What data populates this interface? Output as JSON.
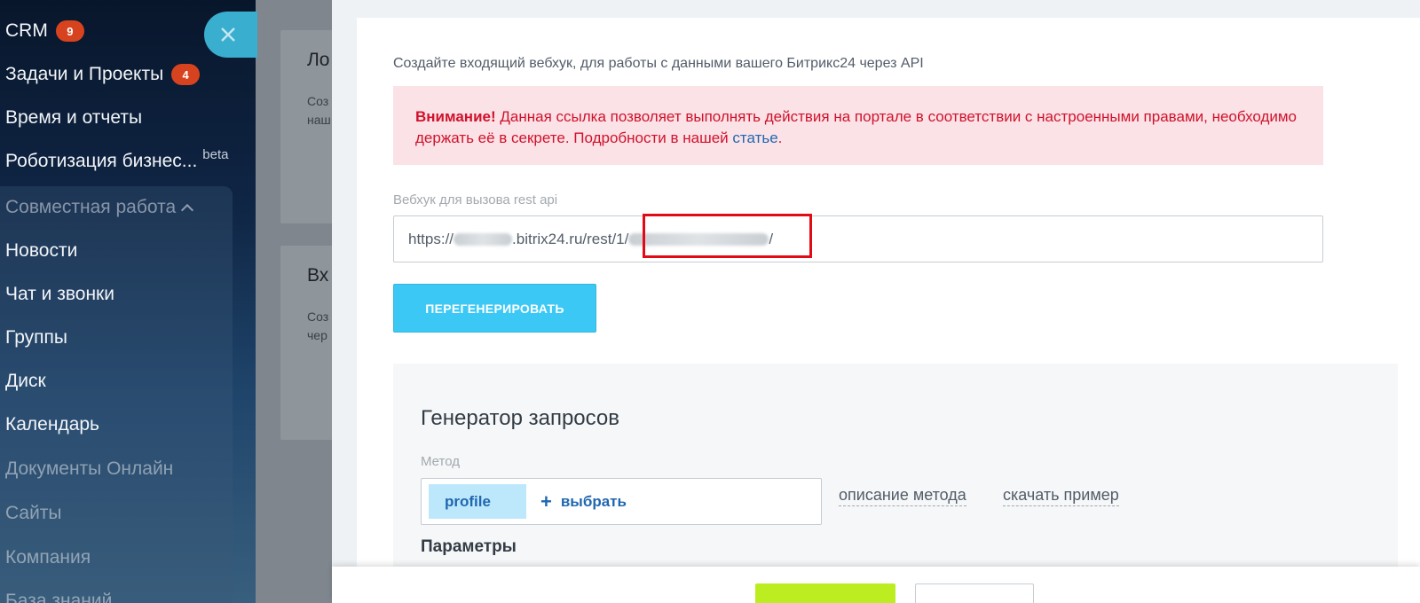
{
  "sidebar": {
    "items": [
      {
        "label": "CRM",
        "badge": "9"
      },
      {
        "label": "Задачи и Проекты",
        "badge": "4"
      },
      {
        "label": "Время и отчеты"
      },
      {
        "label": "Роботизация бизнес...",
        "tag": "beta"
      },
      {
        "label": "Совместная работа"
      },
      {
        "label": "Новости"
      },
      {
        "label": "Чат и звонки"
      },
      {
        "label": "Группы"
      },
      {
        "label": "Диск"
      },
      {
        "label": "Календарь"
      },
      {
        "label": "Документы Онлайн"
      },
      {
        "label": "Сайты"
      },
      {
        "label": "Компания"
      },
      {
        "label": "База знаний"
      }
    ]
  },
  "background_cards": [
    {
      "title": "Ло",
      "text_line1": "Соз",
      "text_line2": "наш"
    },
    {
      "title": "Вх",
      "text_line1": "Соз",
      "text_line2": "чер"
    }
  ],
  "panel": {
    "intro": "Создайте входящий вебхук, для работы с данными вашего Битрикс24 через API",
    "alert": {
      "strong": "Внимание!",
      "text": " Данная ссылка позволяет выполнять действия на портале в соответствии с настроенными правами, необходимо держать её в секрете. Подробности в нашей ",
      "link": "статье",
      "end": "."
    },
    "webhook_label": "Вебхук для вызова rest api",
    "webhook": {
      "prefix": "https://",
      "middle": ".bitrix24.ru/rest/1/",
      "suffix": "/"
    },
    "regenerate_label": "ПЕРЕГЕНЕРИРОВАТЬ",
    "generator": {
      "title": "Генератор запросов",
      "method_label": "Метод",
      "method_value": "profile",
      "method_select": "выбрать",
      "method_select_plus": "+",
      "method_description": "описание метода",
      "download_example": "скачать пример",
      "params_title": "Параметры"
    }
  },
  "colors": {
    "accent": "#3bc8f5",
    "alert_bg": "#fbe2e6",
    "alert_text": "#d0122c",
    "link": "#2067b0",
    "badge": "#d8431f",
    "save_button": "#bbed21",
    "highlight": "#e00b14"
  }
}
